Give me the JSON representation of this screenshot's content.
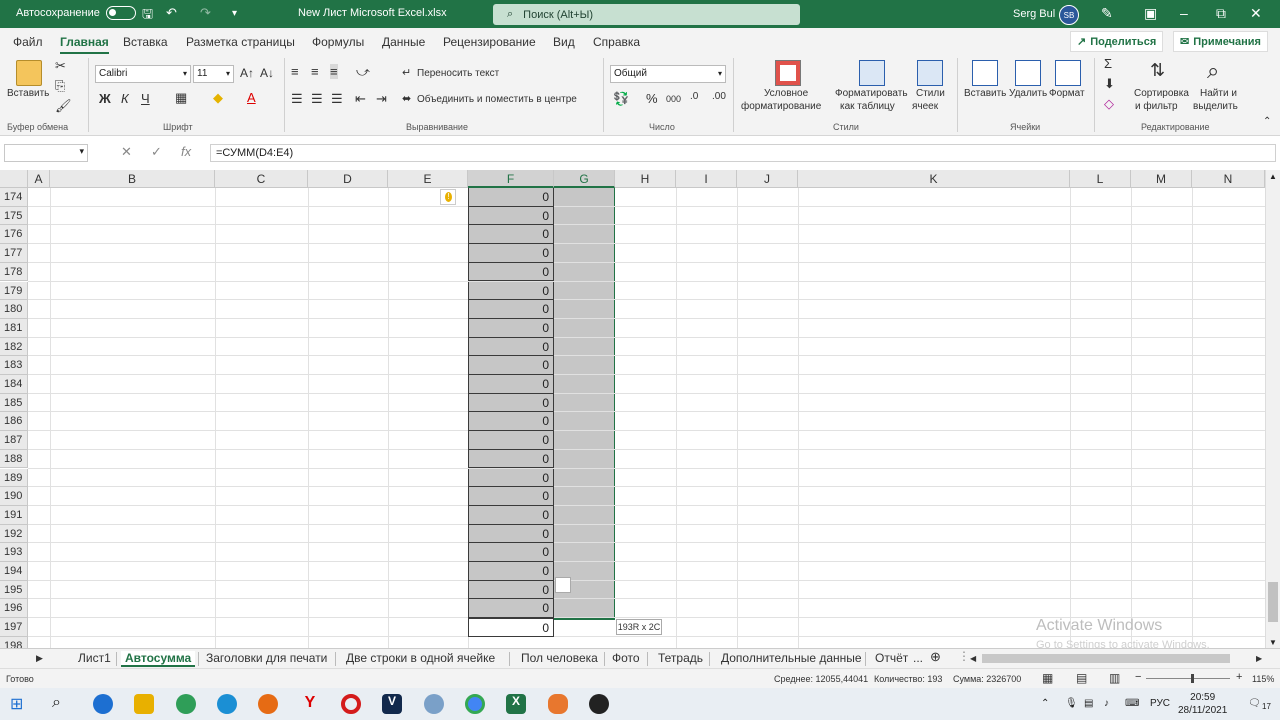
{
  "titlebar": {
    "autosave_label": "Автосохранение",
    "filename": "New Лист Microsoft Excel.xlsx",
    "search_placeholder": "Поиск (Alt+Ы)",
    "user_name": "Serg Bul",
    "user_initials": "SB"
  },
  "menu": {
    "tabs": [
      "Файл",
      "Главная",
      "Вставка",
      "Разметка страницы",
      "Формулы",
      "Данные",
      "Рецензирование",
      "Вид",
      "Справка"
    ],
    "active_tab": "Главная",
    "share_label": "Поделиться",
    "comments_label": "Примечания"
  },
  "ribbon": {
    "clipboard": {
      "paste_label": "Вставить",
      "group_label": "Буфер обмена"
    },
    "font": {
      "name": "Calibri",
      "size": "11",
      "bold": "Ж",
      "italic": "К",
      "underline": "Ч",
      "group_label": "Шрифт"
    },
    "alignment": {
      "wrap_label": "Переносить текст",
      "merge_label": "Объединить и поместить в центре",
      "group_label": "Выравнивание"
    },
    "number": {
      "format": "Общий",
      "group_label": "Число"
    },
    "styles": {
      "conditional_1": "Условное",
      "conditional_2": "форматирование",
      "as_table_1": "Форматировать",
      "as_table_2": "как таблицу",
      "cell_styles_1": "Стили",
      "cell_styles_2": "ячеек",
      "group_label": "Стили"
    },
    "cells": {
      "insert_label": "Вставить",
      "delete_label": "Удалить",
      "format_label": "Формат",
      "group_label": "Ячейки"
    },
    "editing": {
      "sort_1": "Сортировка",
      "sort_2": "и фильтр",
      "find_1": "Найти и",
      "find_2": "выделить",
      "group_label": "Редактирование"
    }
  },
  "formula_bar": {
    "name_box": "",
    "formula": "=СУММ(D4:E4)"
  },
  "grid": {
    "columns": [
      "A",
      "B",
      "C",
      "D",
      "E",
      "F",
      "G",
      "H",
      "I",
      "J",
      "K",
      "L",
      "M",
      "N"
    ],
    "rows": [
      "174",
      "175",
      "176",
      "177",
      "178",
      "179",
      "180",
      "181",
      "182",
      "183",
      "184",
      "185",
      "186",
      "187",
      "188",
      "189",
      "190",
      "191",
      "192",
      "193",
      "194",
      "195",
      "196",
      "197",
      "198"
    ],
    "f_values": [
      "0",
      "0",
      "0",
      "0",
      "0",
      "0",
      "0",
      "0",
      "0",
      "0",
      "0",
      "0",
      "0",
      "0",
      "0",
      "0",
      "0",
      "0",
      "0",
      "0",
      "0",
      "0",
      "0",
      "0"
    ],
    "selection_tooltip": "193R x 2C"
  },
  "watermark": {
    "line1": "Activate Windows",
    "line2": "Go to Settings to activate Windows."
  },
  "sheets": {
    "tabs": [
      "Лист1",
      "Автосумма",
      "Заголовки для печати",
      "Две строки в одной ячейке",
      "Пол человека",
      "Фото",
      "Тетрадь",
      "Дополнительные данные",
      "Отчёт"
    ],
    "active": "Автосумма",
    "more": "..."
  },
  "status": {
    "ready": "Готово",
    "average": "Среднее: 12055,44041",
    "count": "Количество: 193",
    "sum": "Сумма: 2326700",
    "zoom": "115%"
  },
  "taskbar": {
    "language": "РУС",
    "time": "20:59",
    "date": "28/11/2021",
    "notification_count": "17"
  },
  "colors": {
    "excel_green": "#217346",
    "selection_gray": "#c6c6c6"
  }
}
